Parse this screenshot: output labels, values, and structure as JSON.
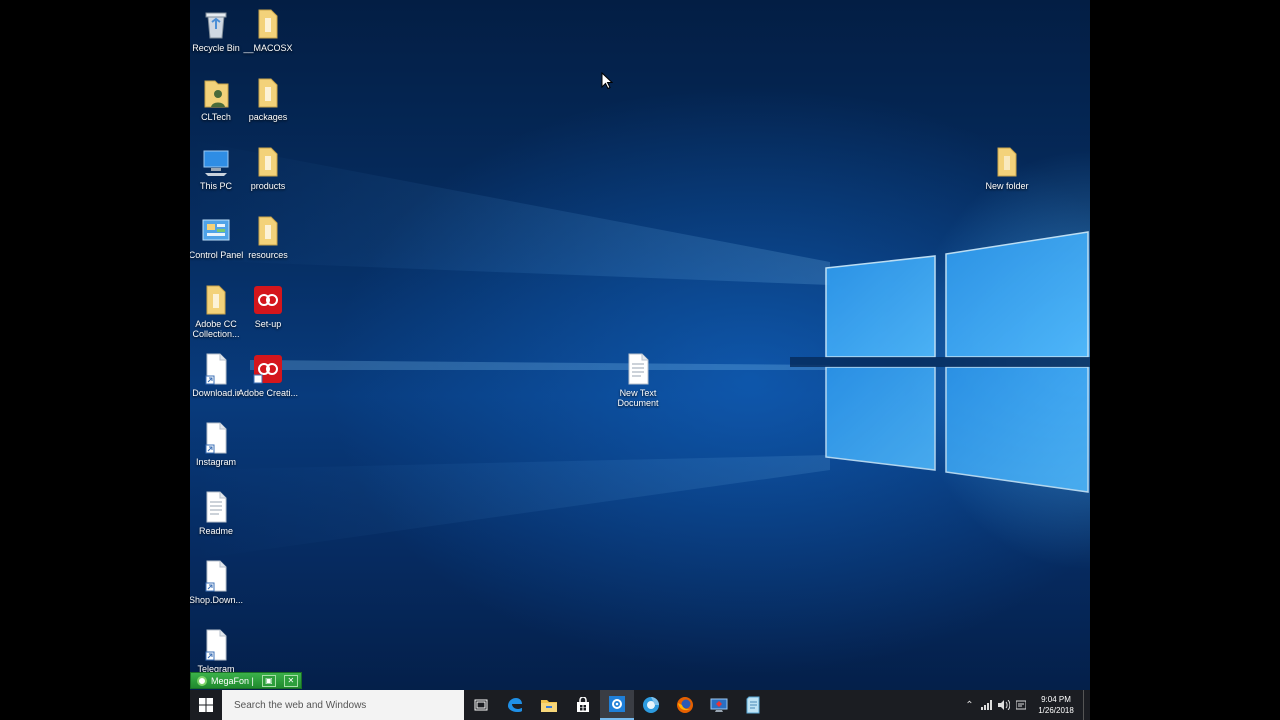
{
  "desktop": {
    "icons": [
      {
        "label": "Recycle Bin",
        "icon": "recycle-bin-icon"
      },
      {
        "label": "__MACOSX",
        "icon": "folder-icon"
      },
      {
        "label": "CLTech",
        "icon": "user-folder-icon"
      },
      {
        "label": "packages",
        "icon": "folder-icon"
      },
      {
        "label": "This PC",
        "icon": "computer-icon"
      },
      {
        "label": "products",
        "icon": "folder-icon"
      },
      {
        "label": "Control Panel",
        "icon": "control-panel-icon"
      },
      {
        "label": "resources",
        "icon": "folder-icon"
      },
      {
        "label": "Adobe CC Collection...",
        "icon": "folder-icon"
      },
      {
        "label": "Set-up",
        "icon": "adobe-cc-icon"
      },
      {
        "label": "Download.ir",
        "icon": "shortcut-file-icon"
      },
      {
        "label": "Adobe Creati...",
        "icon": "adobe-cc-icon"
      },
      {
        "label": "Instagram",
        "icon": "shortcut-file-icon"
      },
      {
        "label": "Readme",
        "icon": "text-file-icon"
      },
      {
        "label": "Shop.Down...",
        "icon": "shortcut-file-icon"
      },
      {
        "label": "Telegram",
        "icon": "shortcut-file-icon"
      },
      {
        "label": "New folder",
        "icon": "folder-icon"
      },
      {
        "label": "New Text Document",
        "icon": "text-file-icon"
      }
    ]
  },
  "megafon": {
    "label": "MegaFon |"
  },
  "taskbar": {
    "search_placeholder": "Search the web and Windows",
    "apps": [
      "task-view-icon",
      "edge-icon",
      "file-explorer-icon",
      "store-icon",
      "settings-icon",
      "browser-icon",
      "firefox-icon",
      "remote-desktop-icon",
      "notepad-icon"
    ],
    "clock": {
      "time": "9:04 PM",
      "date": "1/26/2018"
    }
  },
  "colors": {
    "taskbar": "#1b1d22",
    "folder": "#f3d27a",
    "adobe": "#d4161c",
    "accent": "#76b9ed"
  }
}
